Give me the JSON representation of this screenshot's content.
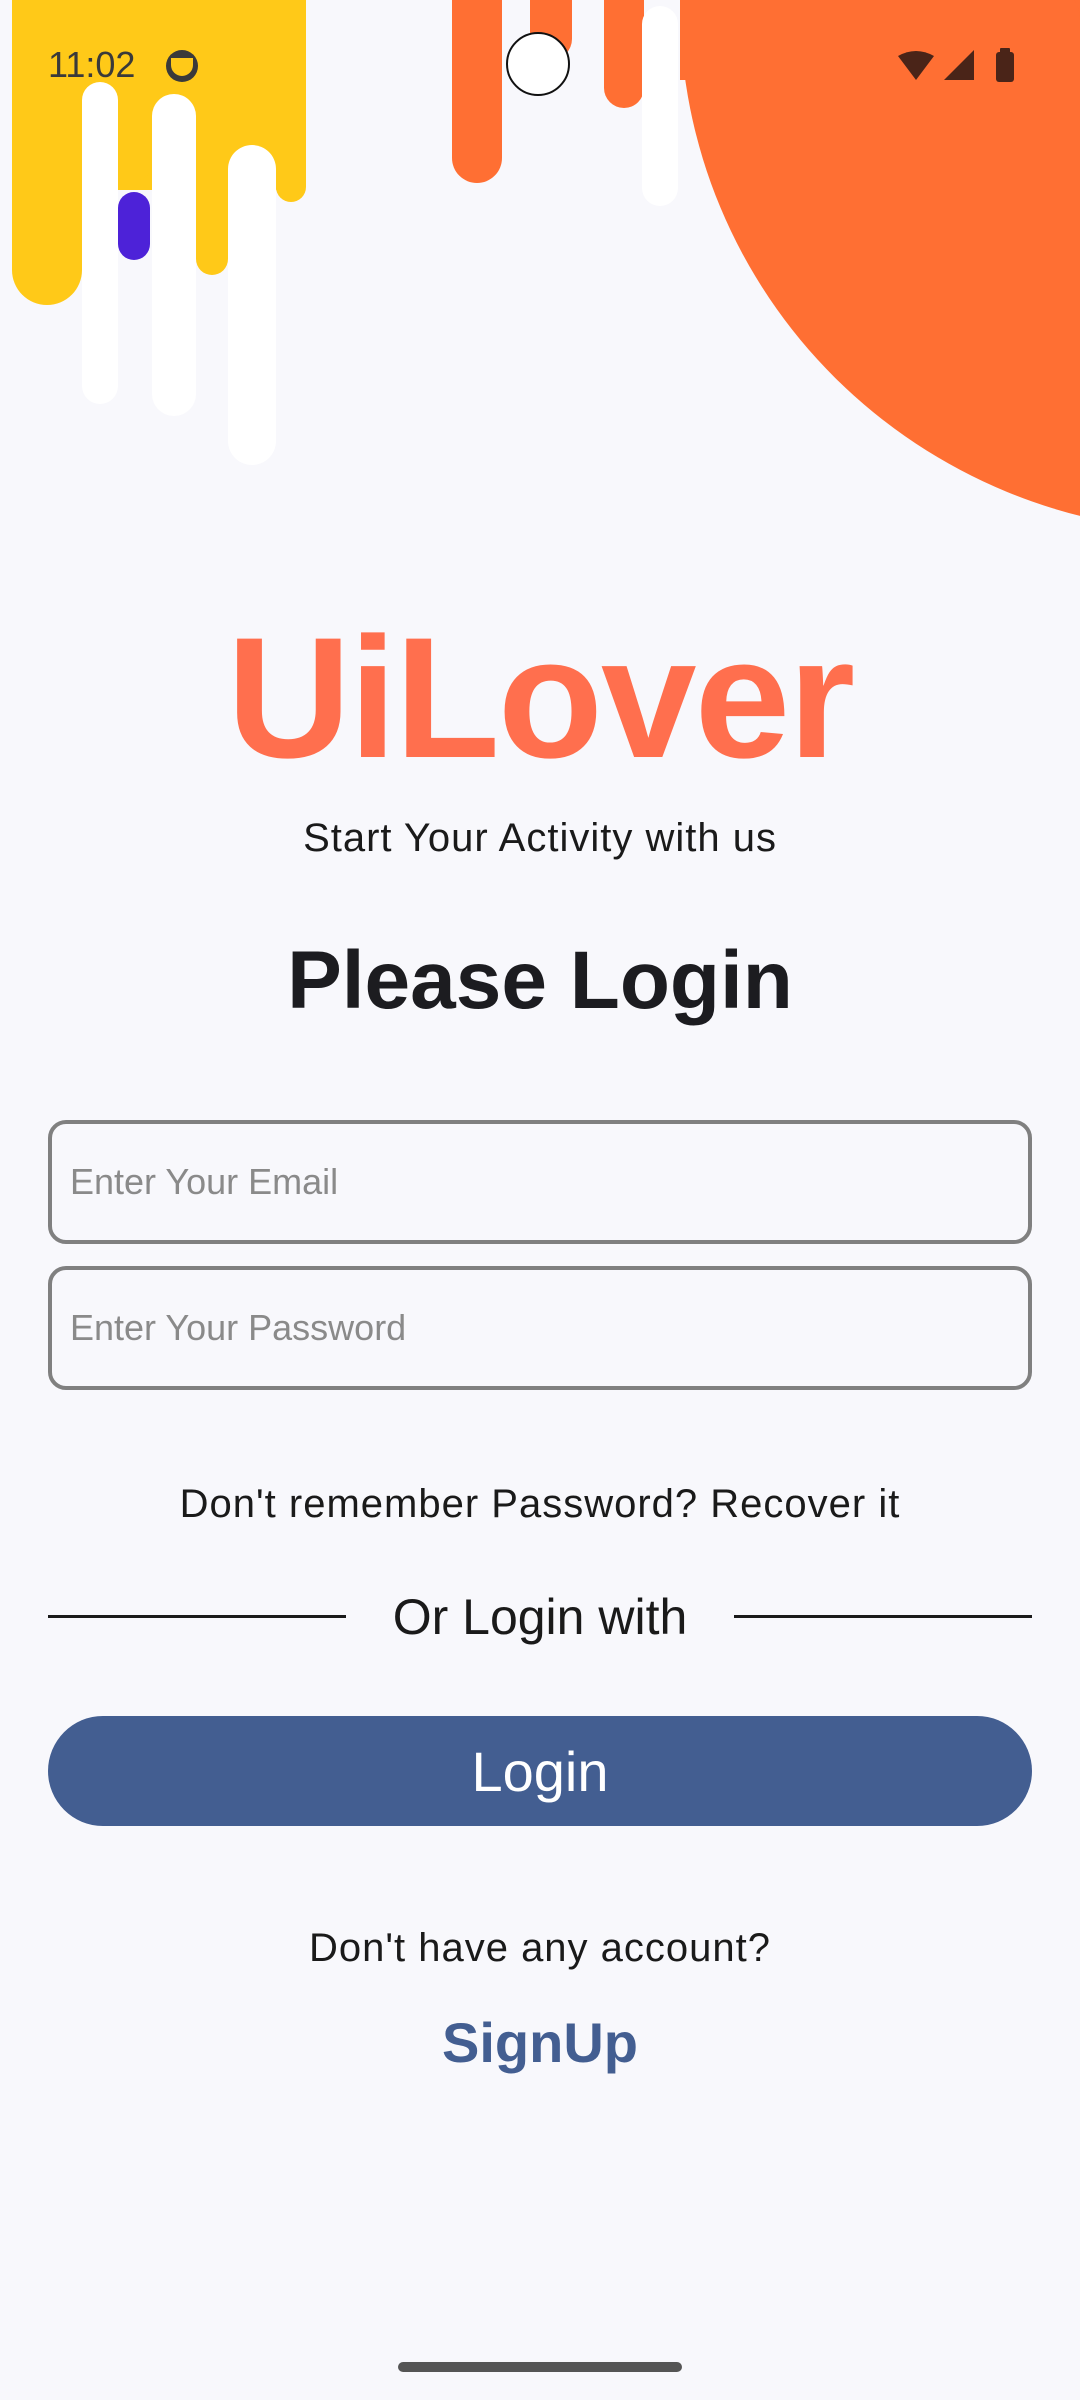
{
  "status_bar": {
    "time": "11:02"
  },
  "brand": {
    "name": "UiLover",
    "tagline": "Start Your Activity with us"
  },
  "heading": "Please Login",
  "form": {
    "email_placeholder": "Enter Your Email",
    "email_value": "",
    "password_placeholder": "Enter Your Password",
    "password_value": ""
  },
  "recover_text": "Don't remember Password? Recover it",
  "divider_text": "Or Login with",
  "login_button_label": "Login",
  "no_account_text": "Don't have any account?",
  "signup_label": "SignUp",
  "colors": {
    "background": "#f8f8fc",
    "brand": "#ff6f4e",
    "primary": "#435e91",
    "deco_yellow": "#ffc918",
    "deco_orange": "#ff6f33",
    "deco_purple": "#4d22d8"
  },
  "icons": {
    "status_left": "smiley-icon",
    "status_right": [
      "wifi-icon",
      "cellular-signal-icon",
      "battery-icon"
    ]
  }
}
